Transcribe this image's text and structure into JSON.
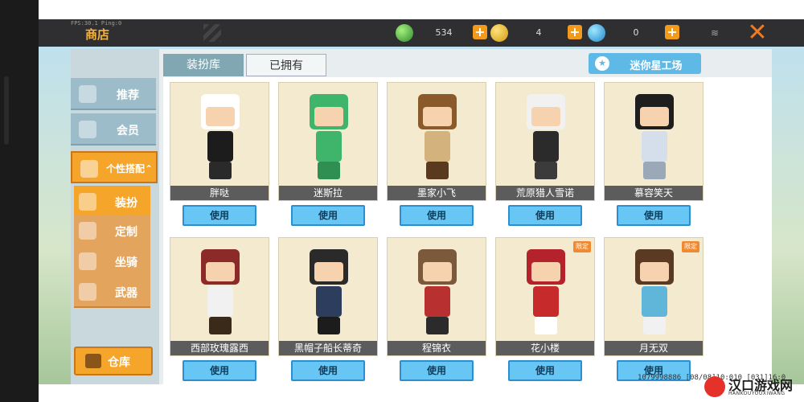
{
  "header": {
    "fps_text": "FPS:30.1  Ping:0",
    "title": "商店",
    "resources": [
      {
        "name": "green-gem",
        "value": "534"
      },
      {
        "name": "gold-coin",
        "value": "4"
      },
      {
        "name": "blue-coin",
        "value": "0"
      }
    ]
  },
  "sidebar": {
    "items": [
      {
        "label": "推荐",
        "icon": "thumbs-up-icon"
      },
      {
        "label": "会员",
        "icon": "member-icon"
      },
      {
        "label": "个性搭配",
        "icon": "soccer-icon"
      }
    ],
    "sub_items": [
      {
        "label": "装扮",
        "icon": "outfit-icon"
      },
      {
        "label": "定制",
        "icon": "customize-icon"
      },
      {
        "label": "坐骑",
        "icon": "mount-icon"
      },
      {
        "label": "武器",
        "icon": "weapon-icon"
      }
    ],
    "warehouse_label": "仓库"
  },
  "tabs": [
    {
      "label": "装扮库"
    },
    {
      "label": "已拥有"
    }
  ],
  "factory_label": "迷你星工场",
  "cards": [
    {
      "name": "胖哒",
      "button": "使用",
      "head": "#ffffff",
      "body": "#1c1c1c",
      "legs": "#2a2a2a",
      "tag": ""
    },
    {
      "name": "迷斯拉",
      "button": "使用",
      "head": "#3fb46b",
      "body": "#3fb46b",
      "legs": "#2f8f52",
      "tag": ""
    },
    {
      "name": "墨家小飞",
      "button": "使用",
      "head": "#8a5a2b",
      "body": "#d4b27d",
      "legs": "#5a3a1f",
      "tag": ""
    },
    {
      "name": "荒原猎人雪诺",
      "button": "使用",
      "head": "#f1f1f1",
      "body": "#2b2b2b",
      "legs": "#3b3b3b",
      "tag": ""
    },
    {
      "name": "慕容笑天",
      "button": "使用",
      "head": "#1e1e1e",
      "body": "#d5dfeb",
      "legs": "#9aa8b8",
      "tag": ""
    },
    {
      "name": "西部玫瑰露西",
      "button": "使用",
      "head": "#8c2a2a",
      "body": "#f1f1f1",
      "legs": "#3a2a1a",
      "tag": ""
    },
    {
      "name": "黑帽子船长蒂奇",
      "button": "使用",
      "head": "#2a2a2a",
      "body": "#2c3d5e",
      "legs": "#1c1c1c",
      "tag": ""
    },
    {
      "name": "程锦衣",
      "button": "使用",
      "head": "#7a5a3a",
      "body": "#b83030",
      "legs": "#2b2b2b",
      "tag": ""
    },
    {
      "name": "花小楼",
      "button": "使用",
      "head": "#b4232b",
      "body": "#c72a2a",
      "legs": "#ffffff",
      "tag": "限定"
    },
    {
      "name": "月无双",
      "button": "使用",
      "head": "#5a3a22",
      "body": "#5fb6d9",
      "legs": "#f1f1f1",
      "tag": "限定"
    }
  ],
  "footer_id": "1079998886  [08/08]10:010  [031]16:0",
  "watermark": {
    "title": "汉口游戏网",
    "subtitle": "HANKOUYOUXIWANG"
  }
}
